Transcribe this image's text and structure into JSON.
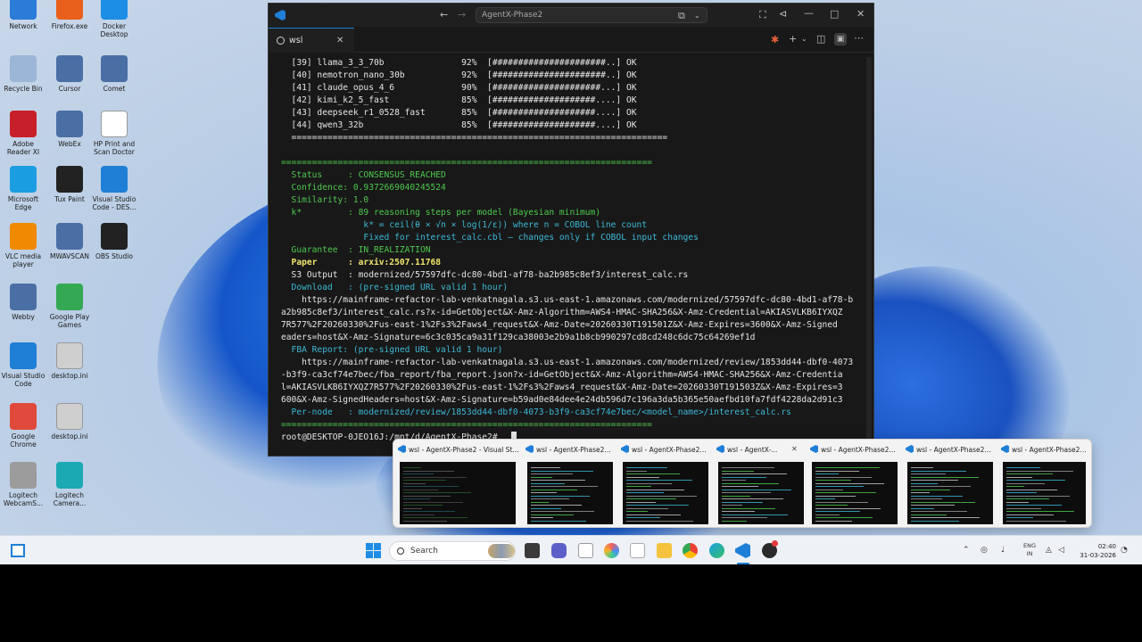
{
  "desktop": {
    "icons": [
      {
        "label": "Network",
        "icon": "network-icon",
        "color": "#2b7bd8"
      },
      {
        "label": "Firefox.exe",
        "icon": "firefox-icon",
        "color": "#e8601c"
      },
      {
        "label": "Docker Desktop",
        "icon": "docker-icon",
        "color": "#1d8ee6"
      },
      {
        "label": "Recycle Bin",
        "icon": "recycle-bin-icon",
        "color": "#9bb6d6"
      },
      {
        "label": "Cursor",
        "icon": "shortcut-icon",
        "color": "#4a6fa5"
      },
      {
        "label": "Comet",
        "icon": "shortcut-icon",
        "color": "#4a6fa5"
      },
      {
        "label": "Adobe Reader XI",
        "icon": "pdf-icon",
        "color": "#c8202b"
      },
      {
        "label": "WebEx",
        "icon": "shortcut-icon",
        "color": "#4a6fa5"
      },
      {
        "label": "HP Print and Scan Doctor",
        "icon": "hp-icon",
        "color": "#ffffff"
      },
      {
        "label": "Microsoft Edge",
        "icon": "edge-icon",
        "color": "#1b9de2"
      },
      {
        "label": "Tux Paint",
        "icon": "tux-icon",
        "color": "#222222"
      },
      {
        "label": "Visual Studio Code - DES...",
        "icon": "vscode-icon",
        "color": "#1f7fd6"
      },
      {
        "label": "VLC media player",
        "icon": "vlc-icon",
        "color": "#f08a00"
      },
      {
        "label": "MWAVSCAN",
        "icon": "shortcut-icon",
        "color": "#4a6fa5"
      },
      {
        "label": "OBS Studio",
        "icon": "obs-icon",
        "color": "#222222"
      },
      {
        "label": "Webby",
        "icon": "shortcut-icon",
        "color": "#4a6fa5"
      },
      {
        "label": "Google Play Games",
        "icon": "play-games-icon",
        "color": "#34a853"
      },
      {
        "label": "Visual Studio Code",
        "icon": "vscode-icon",
        "color": "#1f7fd6"
      },
      {
        "label": "desktop.ini",
        "icon": "settings-file-icon",
        "color": "#cfcfcf"
      },
      {
        "label": "Google Chrome",
        "icon": "chrome-icon",
        "color": "#e04a3a"
      },
      {
        "label": "desktop.ini",
        "icon": "settings-file-icon",
        "color": "#cfcfcf"
      },
      {
        "label": "Logitech WebcamS...",
        "icon": "logitech-icon",
        "color": "#9c9c9c"
      },
      {
        "label": "Logitech Camera...",
        "icon": "logitech-camera-icon",
        "color": "#1ba9b4"
      }
    ]
  },
  "window": {
    "title": "AgentX-Phase2",
    "tab_label": "wsl",
    "accent": "#1f7fd6"
  },
  "terminal": {
    "lines": [
      {
        "text": "  [39] llama_3_3_70b               92%  [######################..] OK",
        "style": "c-white"
      },
      {
        "text": "  [40] nemotron_nano_30b           92%  [######################..] OK",
        "style": "c-white"
      },
      {
        "text": "  [41] claude_opus_4_6             90%  [#####################...] OK",
        "style": "c-white"
      },
      {
        "text": "  [42] kimi_k2_5_fast              85%  [####################....] OK",
        "style": "c-white"
      },
      {
        "text": "  [43] deepseek_r1_0528_fast       85%  [####################....] OK",
        "style": "c-white"
      },
      {
        "text": "  [44] qwen3_32b                   85%  [####################....] OK",
        "style": "c-white"
      },
      {
        "text": "  =========================================================================",
        "style": "c-white"
      },
      {
        "text": "",
        "style": "c-white"
      },
      {
        "text": "========================================================================",
        "style": "c-green"
      },
      {
        "text": "  Status     : CONSENSUS_REACHED",
        "style": "c-green"
      },
      {
        "text": "  Confidence: 0.9372669040245524",
        "style": "c-green"
      },
      {
        "text": "  Similarity: 1.0",
        "style": "c-green"
      },
      {
        "text": "  k*         : 89 reasoning steps per model (Bayesian minimum)",
        "style": "c-green"
      },
      {
        "text": "                k* = ceil(θ × √n × log(1/ε)) where n = COBOL line count",
        "style": "c-cyan"
      },
      {
        "text": "                Fixed for interest_calc.cbl — changes only if COBOL input changes",
        "style": "c-cyan"
      },
      {
        "text": "  Guarantee  : IN_REALIZATION",
        "style": "c-green"
      },
      {
        "text": "  Paper      : arxiv:2507.11768",
        "style": "c-yellow"
      },
      {
        "text": "  S3 Output  : modernized/57597dfc-dc80-4bd1-af78-ba2b985c8ef3/interest_calc.rs",
        "style": "c-white"
      },
      {
        "text": "  Download   : (pre-signed URL valid 1 hour)",
        "style": "c-cyan"
      },
      {
        "text": "    https://mainframe-refactor-lab-venkatnagala.s3.us-east-1.amazonaws.com/modernized/57597dfc-dc80-4bd1-af78-b",
        "style": "c-white"
      },
      {
        "text": "a2b985c8ef3/interest_calc.rs?x-id=GetObject&X-Amz-Algorithm=AWS4-HMAC-SHA256&X-Amz-Credential=AKIASVLKB6IYXQZ",
        "style": "c-white"
      },
      {
        "text": "7R577%2F20260330%2Fus-east-1%2Fs3%2Faws4_request&X-Amz-Date=20260330T191501Z&X-Amz-Expires=3600&X-Amz-Signed",
        "style": "c-white"
      },
      {
        "text": "eaders=host&X-Amz-Signature=6c3c035ca9a31f129ca38003e2b9a1b8cb990297cd8cd248c6dc75c64269ef1d",
        "style": "c-white"
      },
      {
        "text": "  FBA Report: (pre-signed URL valid 1 hour)",
        "style": "c-cyan"
      },
      {
        "text": "    https://mainframe-refactor-lab-venkatnagala.s3.us-east-1.amazonaws.com/modernized/review/1853dd44-dbf0-4073",
        "style": "c-white"
      },
      {
        "text": "-b3f9-ca3cf74e7bec/fba_report/fba_report.json?x-id=GetObject&X-Amz-Algorithm=AWS4-HMAC-SHA256&X-Amz-Credentia",
        "style": "c-white"
      },
      {
        "text": "l=AKIASVLKB6IYXQZ7R577%2F20260330%2Fus-east-1%2Fs3%2Faws4_request&X-Amz-Date=20260330T191503Z&X-Amz-Expires=3",
        "style": "c-white"
      },
      {
        "text": "600&X-Amz-SignedHeaders=host&X-Amz-Signature=b59ad0e84dee4e24db596d7c196a3da5b365e50aefbd10fa7fdf4228da2d91c3",
        "style": "c-white"
      },
      {
        "text": "  Per-node   : modernized/review/1853dd44-dbf0-4073-b3f9-ca3cf74e7bec/<model_name>/interest_calc.rs",
        "style": "c-cyan"
      },
      {
        "text": "========================================================================",
        "style": "c-green"
      },
      {
        "text": "root@DESKTOP-0JEO16J:/mnt/d/AgentX-Phase2# ",
        "style": "c-white"
      }
    ]
  },
  "thumbnails": [
    {
      "title": "wsl - AgentX-Phase2 - Visual St..."
    },
    {
      "title": "wsl - AgentX-Phase2..."
    },
    {
      "title": "wsl - AgentX-Phase2..."
    },
    {
      "title": "wsl - AgentX-..."
    },
    {
      "title": "wsl - AgentX-Phase2..."
    },
    {
      "title": "wsl - AgentX-Phase2..."
    },
    {
      "title": "wsl - AgentX-Phase2..."
    }
  ],
  "taskbar": {
    "search_placeholder": "Search",
    "lang_top": "ENG",
    "lang_bottom": "IN",
    "time": "02:40",
    "date": "31-03-2026"
  }
}
